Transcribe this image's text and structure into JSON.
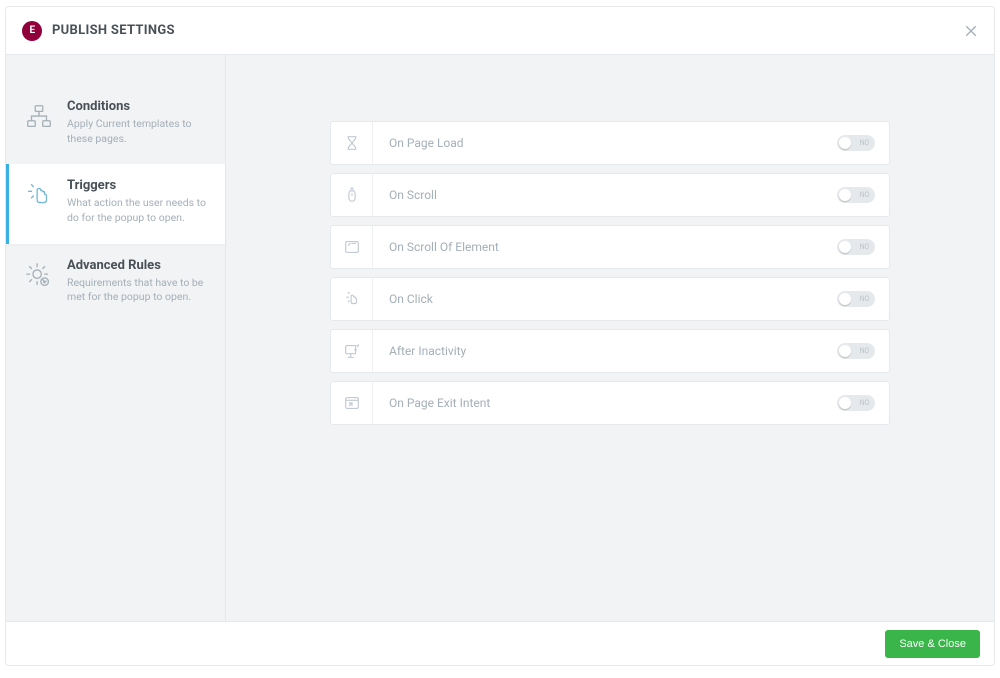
{
  "header": {
    "logo_glyph": "E",
    "title": "PUBLISH SETTINGS"
  },
  "sidebar": {
    "items": [
      {
        "title": "Conditions",
        "desc": "Apply Current templates to these pages."
      },
      {
        "title": "Triggers",
        "desc": "What action the user needs to do for the popup to open."
      },
      {
        "title": "Advanced Rules",
        "desc": "Requirements that have to be met for the popup to open."
      }
    ]
  },
  "triggers": [
    {
      "label": "On Page Load",
      "on": false,
      "off_label": "NO"
    },
    {
      "label": "On Scroll",
      "on": false,
      "off_label": "NO"
    },
    {
      "label": "On Scroll Of Element",
      "on": false,
      "off_label": "NO"
    },
    {
      "label": "On Click",
      "on": false,
      "off_label": "NO"
    },
    {
      "label": "After Inactivity",
      "on": false,
      "off_label": "NO"
    },
    {
      "label": "On Page Exit Intent",
      "on": false,
      "off_label": "NO"
    }
  ],
  "footer": {
    "save_label": "Save & Close"
  }
}
